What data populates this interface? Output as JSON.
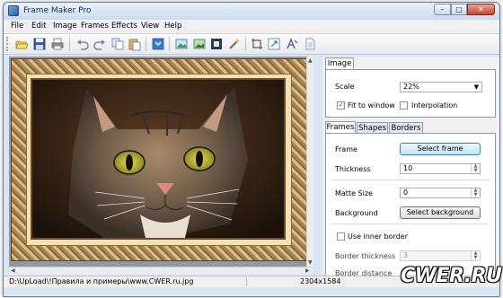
{
  "window": {
    "title": "Frame Maker Pro",
    "controls": {
      "minimize": "–",
      "maximize": "□",
      "close": "✕"
    }
  },
  "menu": [
    "File",
    "Edit",
    "Image",
    "Frames",
    "Effects",
    "View",
    "Help"
  ],
  "toolbar": {
    "buttons": [
      "open-icon",
      "save-icon",
      "print-icon",
      "undo-icon",
      "redo-icon",
      "copy-icon",
      "paste-icon",
      "help-icon",
      "image-icon",
      "landscape-icon",
      "frame-icon",
      "magic-wand-icon",
      "crop-icon",
      "resize-icon",
      "text-effect-icon",
      "document-icon"
    ]
  },
  "image_panel": {
    "tab": "Image",
    "scale_label": "Scale",
    "scale_value": "22%",
    "fit_to_window_label": "Fit to window",
    "fit_to_window_checked": true,
    "interpolation_label": "Interpolation",
    "interpolation_checked": false
  },
  "frame_panel": {
    "tabs": [
      "Frames",
      "Shapes",
      "Borders"
    ],
    "frame_label": "Frame",
    "select_frame_button": "Select frame",
    "thickness_label": "Thickness",
    "thickness_value": "10",
    "matte_size_label": "Matte Size",
    "matte_size_value": "0",
    "background_label": "Background",
    "select_background_button": "Select background",
    "use_inner_border_label": "Use inner border",
    "use_inner_border_checked": false,
    "border_thickness_label": "Border thickness",
    "border_thickness_value": "3",
    "border_distance_label": "Border distance"
  },
  "status": {
    "path": "D:\\UpLoad\\!Правила и примеры\\www.CWER.ru.jpg",
    "dimensions": "2304x1584"
  },
  "watermark": "CWER.RU",
  "colors": {
    "accent": "#3c7fb1",
    "frame_gold": "#d9c08a",
    "frame_dark": "#6a4c22"
  }
}
